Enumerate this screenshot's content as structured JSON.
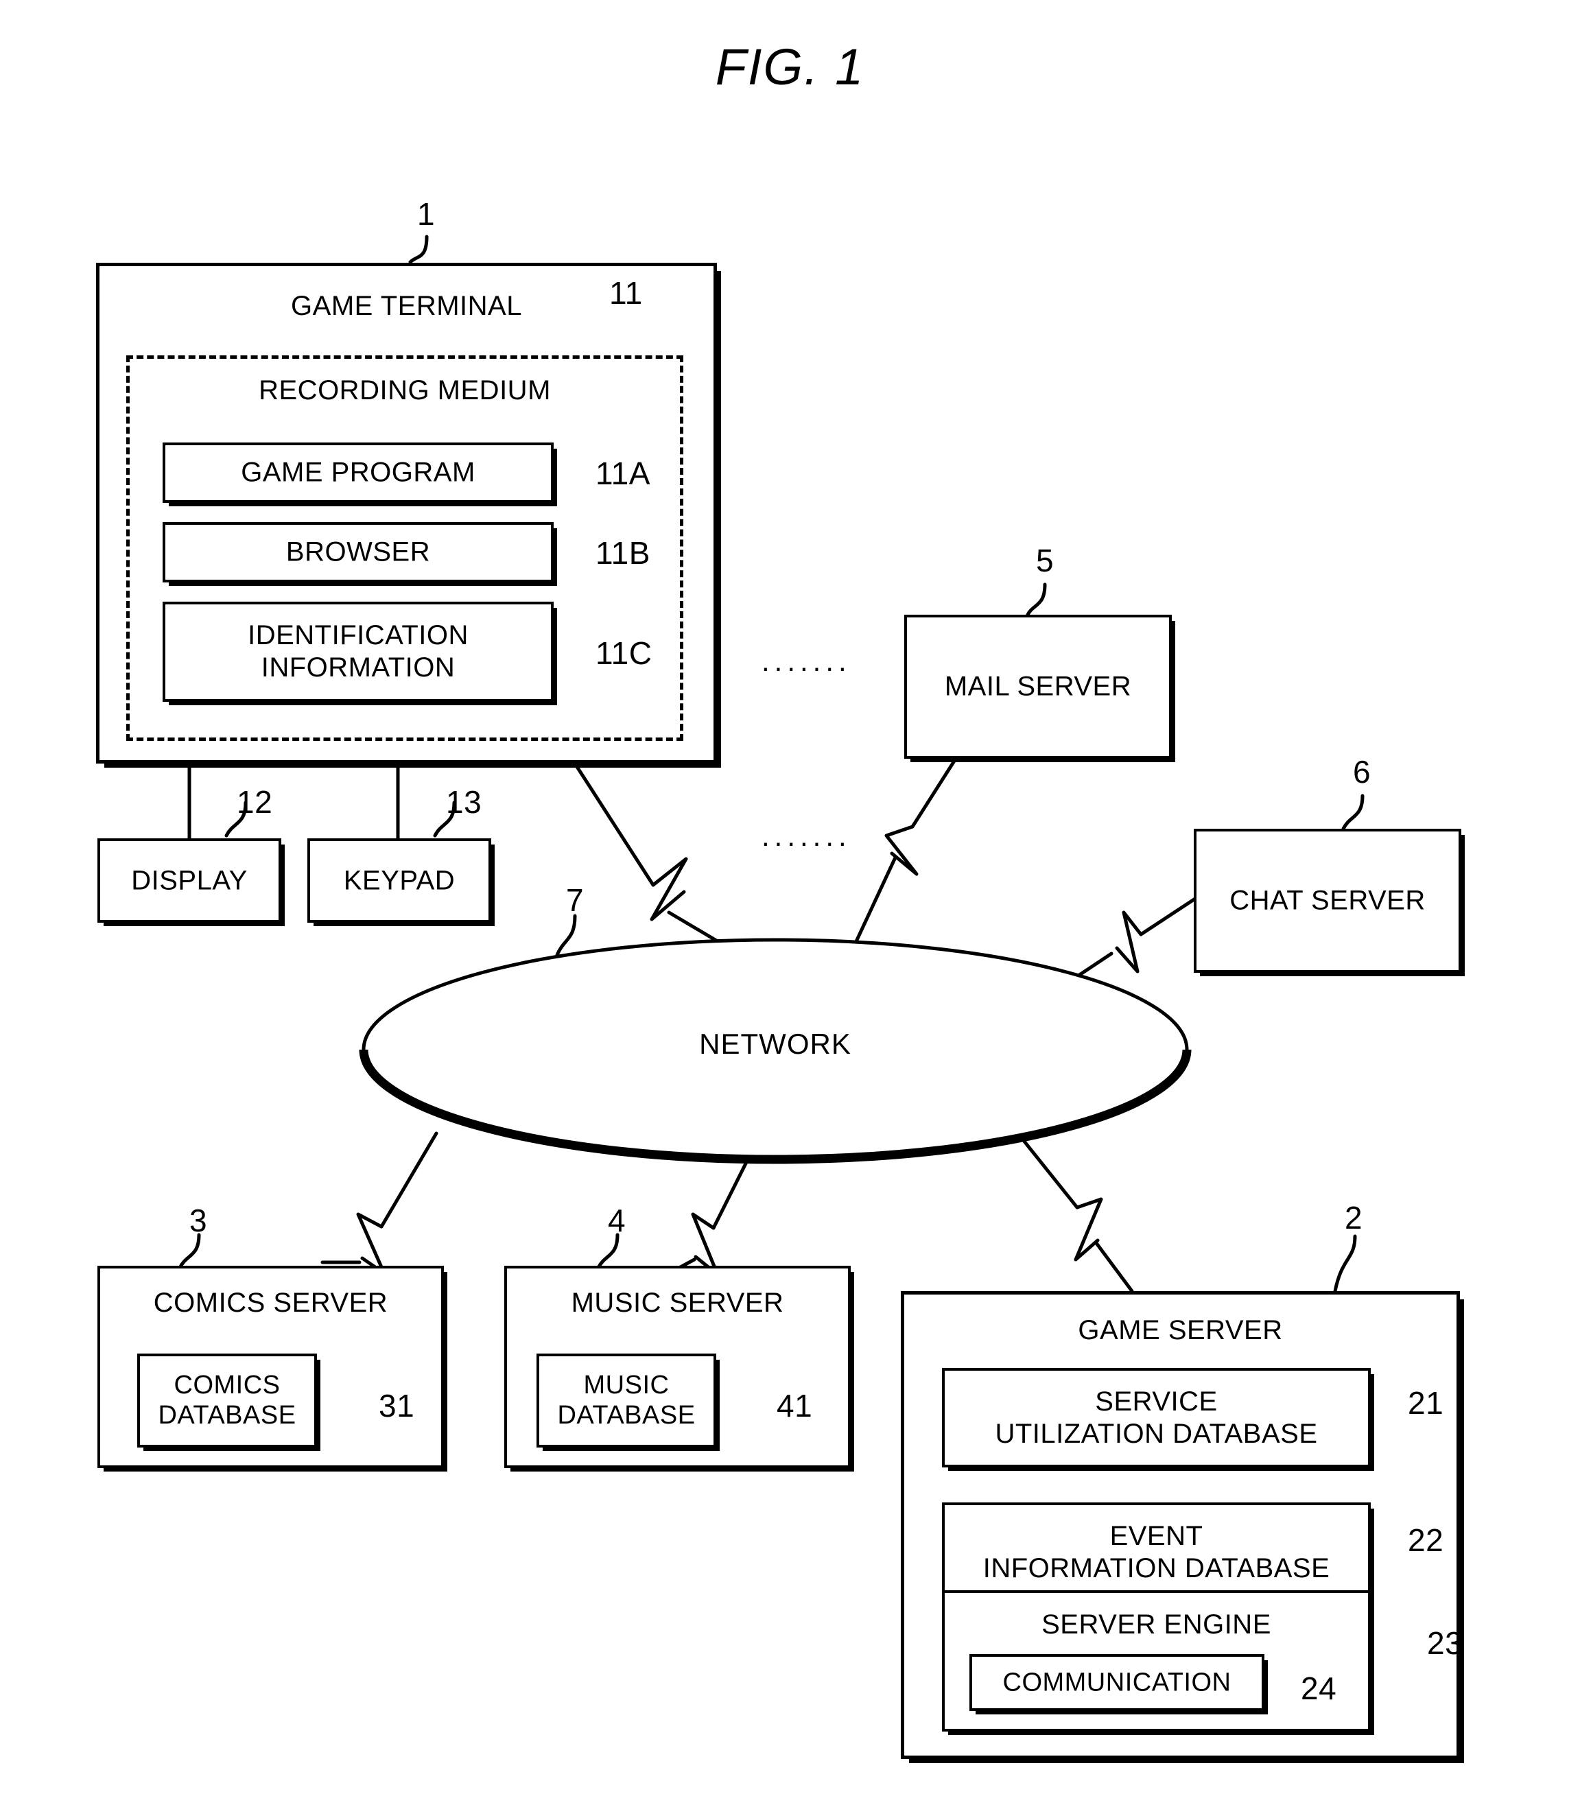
{
  "figure": {
    "title": "FIG. 1"
  },
  "nodes": {
    "game_terminal": {
      "title": "GAME TERMINAL",
      "ref": "1",
      "recording_medium": {
        "title": "RECORDING MEDIUM",
        "ref": "11",
        "items": [
          {
            "label": "GAME PROGRAM",
            "ref": "11A"
          },
          {
            "label": "BROWSER",
            "ref": "11B"
          },
          {
            "label": "IDENTIFICATION\nINFORMATION",
            "ref": "11C"
          }
        ]
      },
      "peripherals": [
        {
          "label": "DISPLAY",
          "ref": "12"
        },
        {
          "label": "KEYPAD",
          "ref": "13"
        }
      ]
    },
    "mail_server": {
      "title": "MAIL SERVER",
      "ref": "5"
    },
    "chat_server": {
      "title": "CHAT SERVER",
      "ref": "6"
    },
    "network": {
      "title": "NETWORK",
      "ref": "7"
    },
    "comics_server": {
      "title": "COMICS SERVER",
      "ref": "3",
      "database": {
        "label": "COMICS\nDATABASE",
        "ref": "31"
      }
    },
    "music_server": {
      "title": "MUSIC SERVER",
      "ref": "4",
      "database": {
        "label": "MUSIC\nDATABASE",
        "ref": "41"
      }
    },
    "game_server": {
      "title": "GAME SERVER",
      "ref": "2",
      "items": [
        {
          "label": "SERVICE\nUTILIZATION DATABASE",
          "ref": "21"
        },
        {
          "label": "EVENT\nINFORMATION DATABASE",
          "ref": "22"
        },
        {
          "label": "SERVER ENGINE",
          "ref": "23"
        }
      ],
      "communication": {
        "label": "COMMUNICATION",
        "ref": "24"
      }
    }
  },
  "ellipses": {
    "upper": ".......",
    "lower": "......."
  }
}
